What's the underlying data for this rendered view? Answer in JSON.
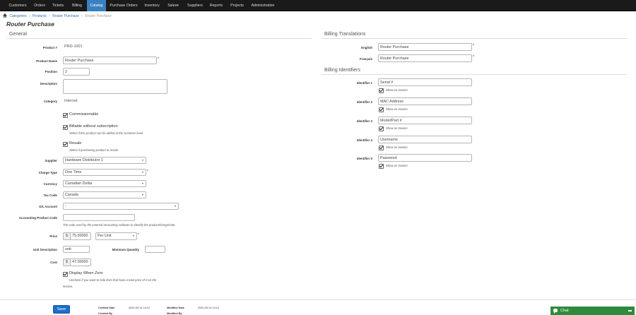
{
  "nav": {
    "items": [
      "Customers",
      "Orders",
      "Tickets",
      "Billing",
      "Catalog",
      "Purchase Orders",
      "Inventory",
      "Sales",
      "Suppliers",
      "Reports",
      "Projects",
      "Administration"
    ],
    "active": "Catalog",
    "active_color": "#3a7fc1",
    "background": "#1a1a1a"
  },
  "breadcrumb": {
    "items": [
      "Categories",
      "Products",
      "Router Purchase",
      "Router Purchase"
    ],
    "separator": "›"
  },
  "page": {
    "title": "Router Purchase"
  },
  "general": {
    "heading": "General",
    "product_num_label": "Product #",
    "product_num": "PRD-1001",
    "product_name_label": "Product Name",
    "product_name": "Router Purchase",
    "position_label": "Position",
    "position": "2",
    "description_label": "Description",
    "description": "",
    "category_label": "Category",
    "category": "Internet",
    "commissionable_label": "Commissionable",
    "billable_label": "Billable without subscription",
    "billable_hint": "Select if this product can be added at the customer level.",
    "resale_label": "Resale",
    "resale_hint": "Select if purchasing product to resale.",
    "supplier_label": "Supplier",
    "supplier": "Hardware Distributor 1",
    "charge_type_label": "Charge Type",
    "charge_type": "One Time",
    "currency_label": "Currency",
    "currency": "Canadian Dollar",
    "tax_code_label": "Tax Code",
    "tax_code": "Canada",
    "gl_account_label": "G/L Account",
    "gl_account": "-",
    "accounting_code_label": "Accounting Product Code",
    "accounting_code": "",
    "accounting_code_hint": "The code used by the external accounting software to identify the product/charge/rate.",
    "price_label": "Price",
    "price_addon": "$",
    "price": "75.00000",
    "price_unit": "Per Unit",
    "unit_desc_label": "Unit Description",
    "unit_desc": "unit",
    "min_qty_label": "Minimum Quantity",
    "min_qty": "",
    "cost_label": "Cost",
    "cost_addon": "$",
    "cost": "47.00000",
    "display_zero_label": "Display When Zero",
    "display_zero_hint_1": "Uncheck if you want to hide lines that have a total price of 0 on the",
    "display_zero_hint_2": "invoice."
  },
  "translations": {
    "heading": "Billing Translations",
    "english_label": "English",
    "english": "Router Purchase",
    "french_label": "Français",
    "french": "Router Purchase"
  },
  "identifiers": {
    "heading": "Billing Identifiers",
    "show_label": "Show on Invoice",
    "items": [
      {
        "label": "Identifier 1",
        "value": "Serial #"
      },
      {
        "label": "Identifier 2",
        "value": "MAC Address"
      },
      {
        "label": "Identifier 3",
        "value": "Model/Part #"
      },
      {
        "label": "Identifier 4",
        "value": "Username"
      },
      {
        "label": "Identifier 5",
        "value": "Password"
      }
    ]
  },
  "footer": {
    "save_label": "Save",
    "created_date_label": "Created Date",
    "created_date": "2020-09-14 14:12",
    "modified_date_label": "Modified Date",
    "modified_date": "2020-09-14 14:12",
    "created_by_label": "Created By",
    "modified_by_label": "Modified By"
  },
  "chat": {
    "label": "Chat",
    "color": "#2e8b3e"
  },
  "required_mark": "*"
}
